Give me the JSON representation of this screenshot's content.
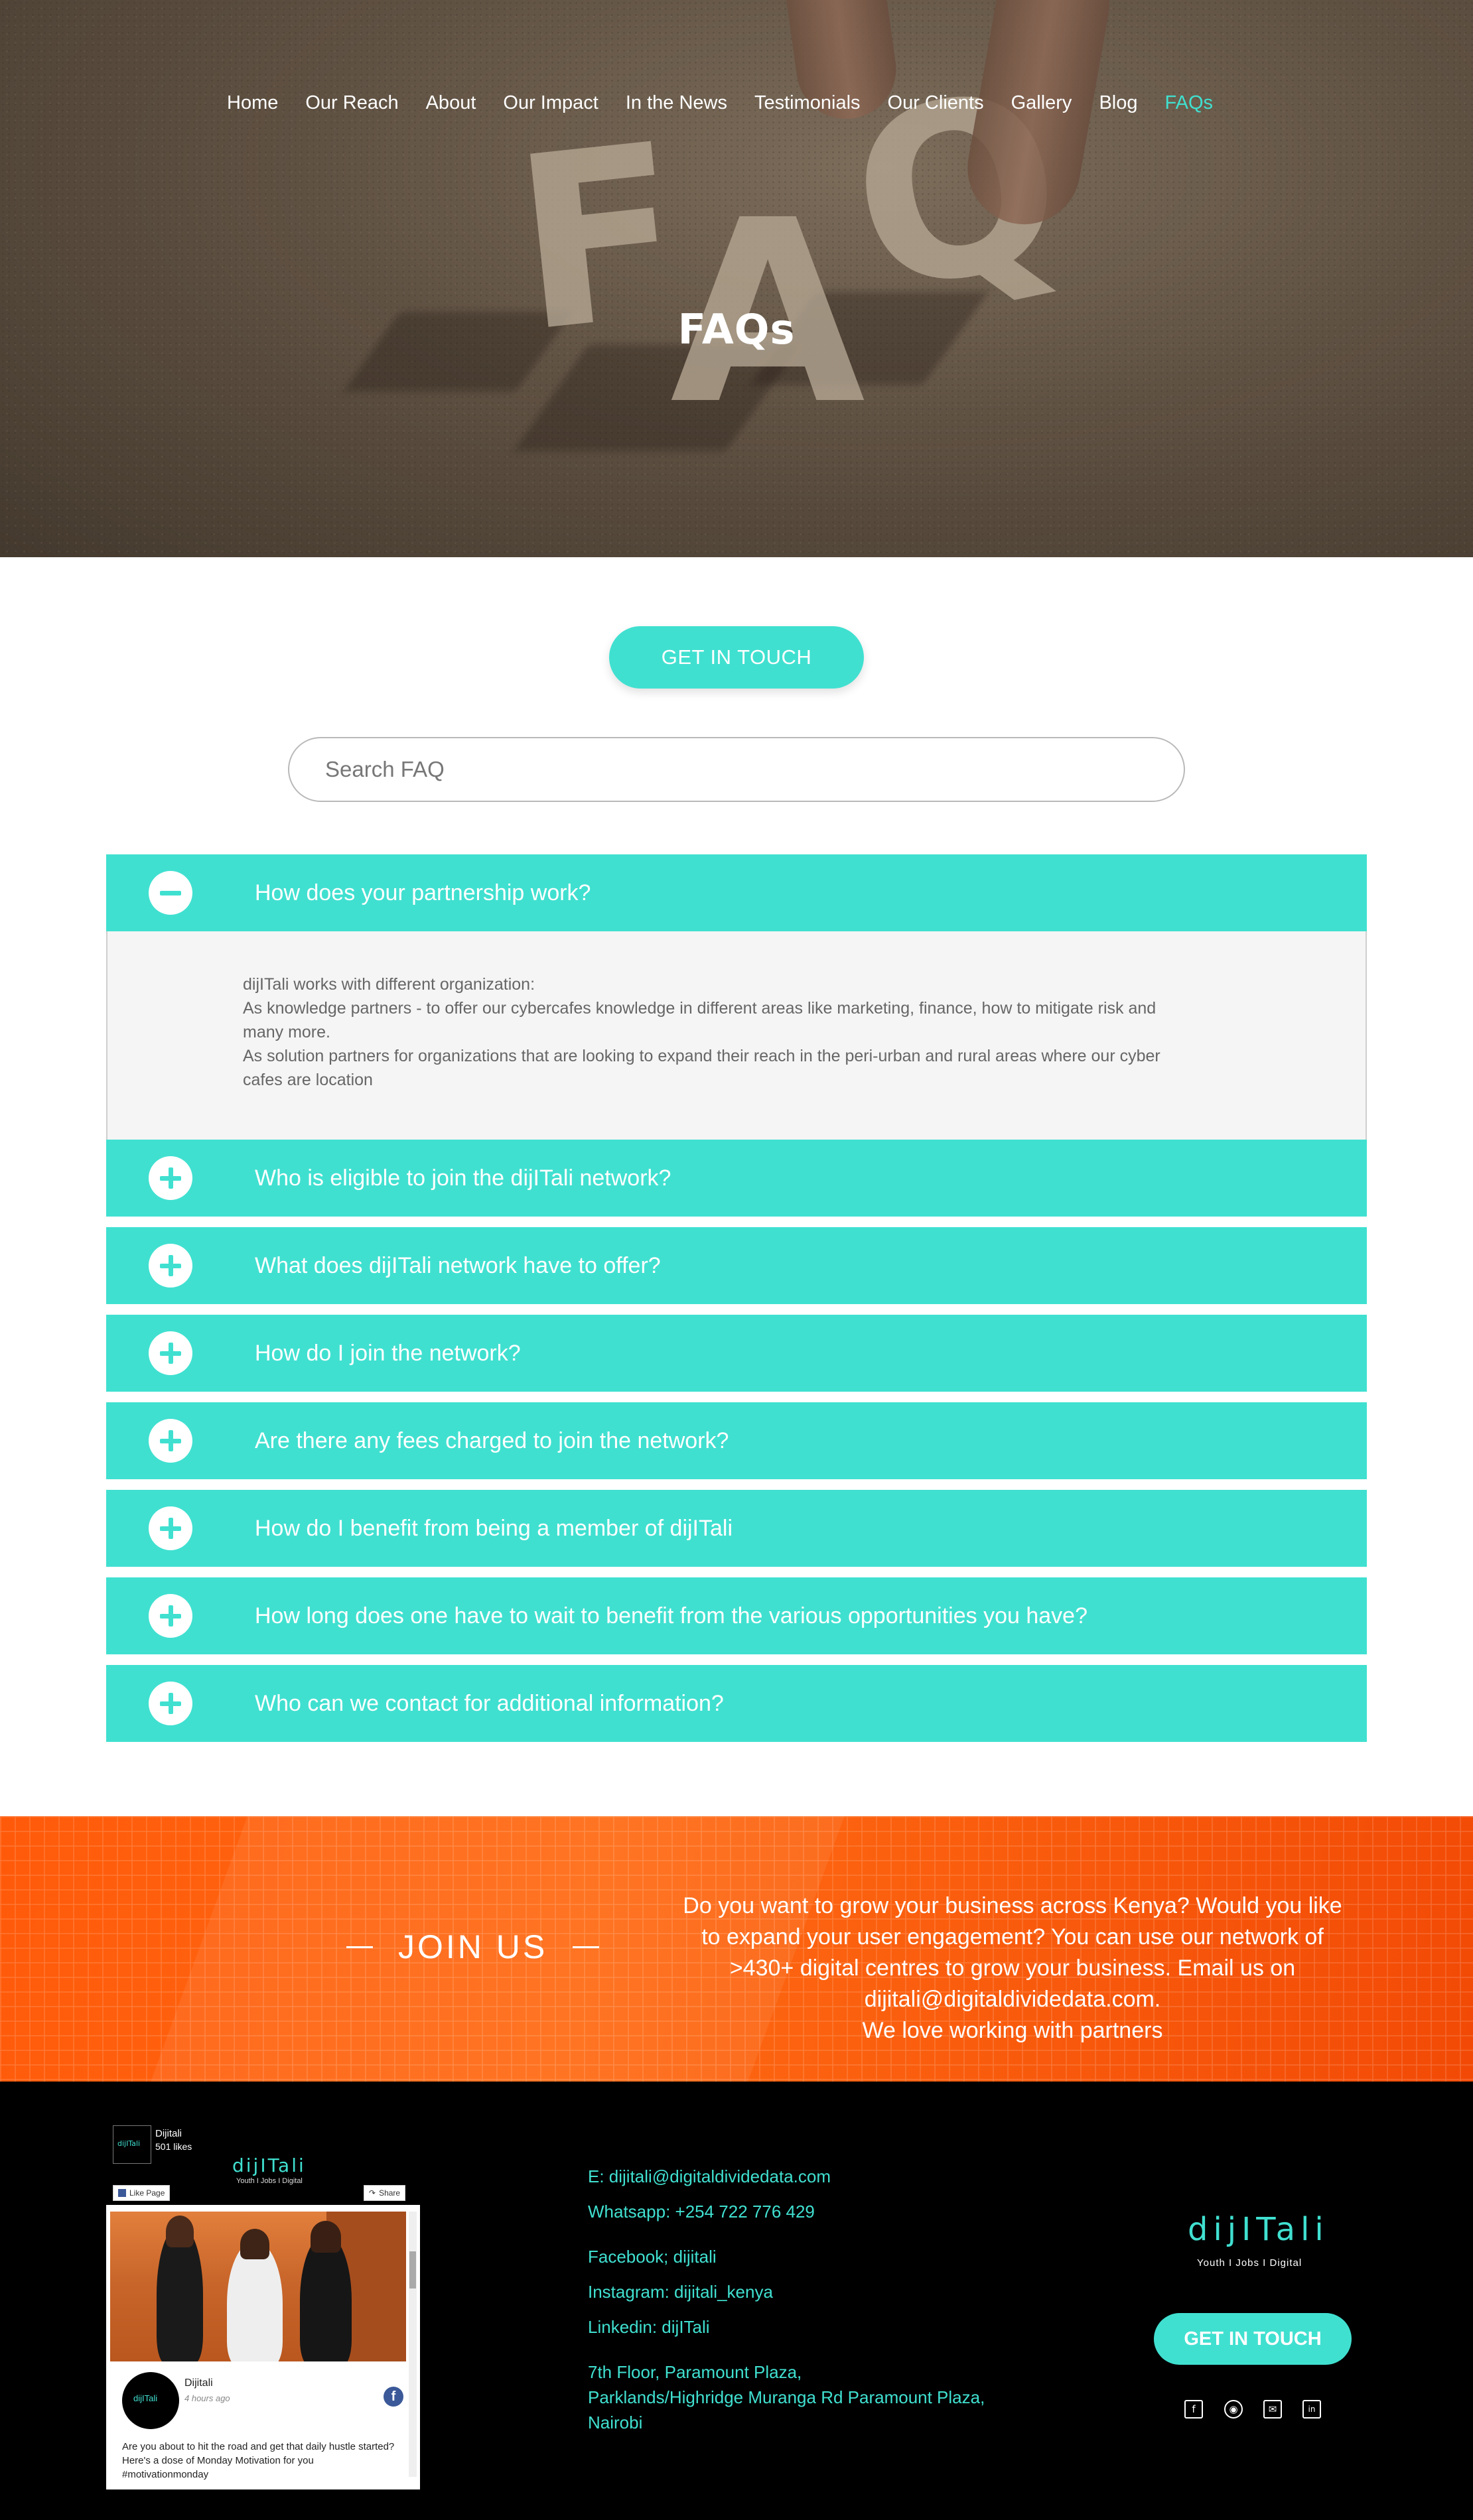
{
  "nav": {
    "items": [
      {
        "label": "Home"
      },
      {
        "label": "Our Reach"
      },
      {
        "label": "About"
      },
      {
        "label": "Our Impact"
      },
      {
        "label": "In the News"
      },
      {
        "label": "Testimonials"
      },
      {
        "label": "Our Clients"
      },
      {
        "label": "Gallery"
      },
      {
        "label": "Blog"
      },
      {
        "label": "FAQs"
      }
    ],
    "active": "FAQs",
    "active_color": "#40e0d0"
  },
  "hero": {
    "title": "FAQs",
    "image_letters": [
      "F",
      "A",
      "Q"
    ]
  },
  "cta": {
    "label": "GET IN TOUCH"
  },
  "search": {
    "placeholder": "Search FAQ",
    "value": ""
  },
  "faq": {
    "accent_color": "#40e0d0",
    "items": [
      {
        "question": "How does your partnership work?",
        "open": true,
        "icon": "minus-icon",
        "answer": [
          "dijITali works with different organization:",
          "As knowledge partners - to offer our cybercafes knowledge in different areas like marketing, finance, how to mitigate risk and many more.",
          "As solution partners for organizations that are looking to expand their reach in the peri-urban and rural areas where our cyber cafes are location"
        ]
      },
      {
        "question": "Who is eligible to join the dijITali network?",
        "open": false,
        "icon": "plus-icon"
      },
      {
        "question": "What does dijITali network have to offer?",
        "open": false,
        "icon": "plus-icon"
      },
      {
        "question": "How do I join the network?",
        "open": false,
        "icon": "plus-icon"
      },
      {
        "question": "Are there any fees charged to join the network?",
        "open": false,
        "icon": "plus-icon"
      },
      {
        "question": "How do I benefit from being a member of dijITali",
        "open": false,
        "icon": "plus-icon"
      },
      {
        "question": "How long does one have to wait to benefit from the various opportunities you have?",
        "open": false,
        "icon": "plus-icon"
      },
      {
        "question": "Who can we contact for additional information?",
        "open": false,
        "icon": "plus-icon"
      }
    ]
  },
  "join": {
    "title": "JOIN US",
    "lines": [
      "Do you want to grow your business across Kenya? Would you like",
      "to expand your user engagement? You can use our network of",
      ">430+ digital centres to grow your business. Email us on",
      "dijitali@digitaldividedata.com.",
      "We love working with partners"
    ]
  },
  "footer": {
    "facebook_widget": {
      "page_name": "Dijitali",
      "likes": "501 likes",
      "brand": "dijITali",
      "tagline": "Youth I Jobs I Digital",
      "like_button": "Like Page",
      "share_button": "Share",
      "post_author": "Dijitali",
      "post_time": "4 hours ago",
      "post_text": "Are you about to hit the road and get that daily hustle started? Here's a dose of Monday Motivation for you #motivationmonday"
    },
    "contact": {
      "email": "E: dijitali@digitaldividedata.com",
      "whatsapp": "Whatsapp: +254 722 776 429",
      "facebook": "Facebook; dijitali",
      "instagram": "Instagram: dijitali_kenya",
      "linkedin": "Linkedin: dijITali",
      "address": [
        "7th Floor, Paramount Plaza,",
        "Parklands/Highridge Muranga Rd Paramount Plaza,",
        "Nairobi"
      ]
    },
    "brand": "dijITali",
    "brand_tagline": "Youth I Jobs I Digital",
    "cta": "GET IN TOUCH",
    "social_icons": [
      "facebook-icon",
      "instagram-icon",
      "email-icon",
      "linkedin-icon"
    ]
  }
}
